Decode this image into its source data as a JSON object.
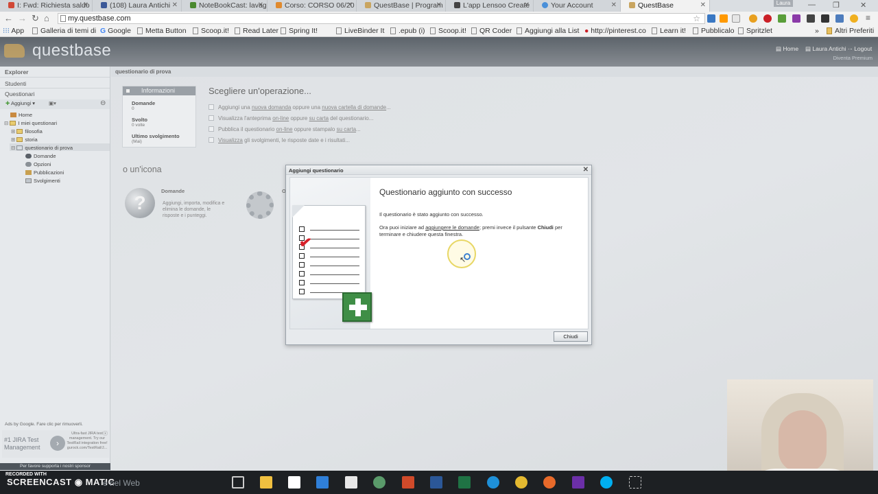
{
  "browser": {
    "tabs": [
      {
        "label": "I: Fwd: Richiesta saldo",
        "icon_color": "#d14836"
      },
      {
        "label": "(108) Laura Antichi",
        "icon_color": "#3b5998"
      },
      {
        "label": "NoteBookCast: lavagn",
        "icon_color": "#4b8a2f"
      },
      {
        "label": "Corso: CORSO 06/20",
        "icon_color": "#e08a2e"
      },
      {
        "label": "QuestBase | Program",
        "icon_color": "#c9a560"
      },
      {
        "label": "L'app Lensoo Create",
        "icon_color": "#444"
      },
      {
        "label": "Your Account",
        "icon_color": "#4a90d9"
      },
      {
        "label": "QuestBase",
        "icon_color": "#c9a560"
      }
    ],
    "user_badge": "Laura",
    "url": "my.questbase.com",
    "bookmarks": [
      "App",
      "Galleria di temi di",
      "Google",
      "Metta Button",
      "Scoop.it!",
      "Read Later",
      "Spring It!",
      "LiveBinder It",
      ".epub (i)",
      "Scoop.it!",
      "QR Coder",
      "Aggiungi alla List",
      "http://pinterest.co",
      "Learn it!",
      "Pubblicalo",
      "Spritzlet",
      "Altri Preferiti"
    ]
  },
  "app": {
    "logo": "questbase",
    "header_links": {
      "home": "Home",
      "user": "Laura Antichi",
      "logout": "Logout",
      "premium": "Diventa Premium"
    }
  },
  "sidebar": {
    "explorer": "Explorer",
    "students": "Studenti",
    "quizzes": "Questionari",
    "add_button": "Aggiungi",
    "tree": [
      {
        "label": "Home",
        "level": 0
      },
      {
        "label": "I miei questionari",
        "level": 0
      },
      {
        "label": "filosofia",
        "level": 1
      },
      {
        "label": "storia",
        "level": 1
      },
      {
        "label": "questionario di prova",
        "level": 1
      },
      {
        "label": "Domande",
        "level": 2
      },
      {
        "label": "Opzioni",
        "level": 2
      },
      {
        "label": "Pubblicazioni",
        "level": 2
      },
      {
        "label": "Svolgimenti",
        "level": 2
      }
    ],
    "ads_label": "Ads by Google. Fare clic per rimuoverli.",
    "ad": {
      "title": "#1 JIRA Test Management",
      "text": "Ultra-fast JIRA test management. Try our TestRail integration free! gurock.com/TestRail/J..."
    },
    "sponsor": "Per favore supporta i nostri sponsor"
  },
  "main": {
    "breadcrumb": "questionario di prova",
    "info": {
      "title": "Informazioni",
      "items": [
        {
          "label": "Domande",
          "value": "0"
        },
        {
          "label": "Svolto",
          "value": "0 volte"
        },
        {
          "label": "Ultimo svolgimento",
          "value": "(Mai)"
        }
      ]
    },
    "operation_title": "Scegliere un'operazione...",
    "operations": [
      {
        "pre": "Aggiungi una ",
        "link1": "nuova domanda",
        "mid": " oppure una ",
        "link2": "nuova cartella di domande",
        "post": "..."
      },
      {
        "pre": "Visualizza l'anteprima ",
        "link1": "on-line",
        "mid": " oppure ",
        "link2": "su carta",
        "post": " del questionario..."
      },
      {
        "pre": "Pubblica il questionario ",
        "link1": "on-line",
        "mid": " oppure stampalo ",
        "link2": "su carta",
        "post": "..."
      },
      {
        "pre": "",
        "link1": "Visualizza",
        "mid": " gli svolgimenti, le risposte date e i risultati...",
        "link2": "",
        "post": ""
      }
    ],
    "icon_title": "o un'icona",
    "icons": [
      {
        "name": "Domande",
        "desc": "Aggiungi, importa, modifica e elimina le domande, le risposte e i punteggi."
      },
      {
        "name": "O",
        "desc": ""
      }
    ]
  },
  "modal": {
    "title": "Aggiungi questionario",
    "heading": "Questionario aggiunto con successo",
    "p1": "Il questionario è stato aggiunto con successo.",
    "p2_pre": "Ora puoi iniziare ad ",
    "p2_link": "aggiungere le domande",
    "p2_mid": "; premi invece il pulsante ",
    "p2_bold": "Chiudi",
    "p2_post": " per terminare e chiudere questa finestra.",
    "close_button": "Chiudi"
  },
  "taskbar": {
    "recorded": "RECORDED WITH",
    "brand": "SCREENCAST",
    "brand2": "MATIC",
    "search_hint": "e nel Web"
  }
}
